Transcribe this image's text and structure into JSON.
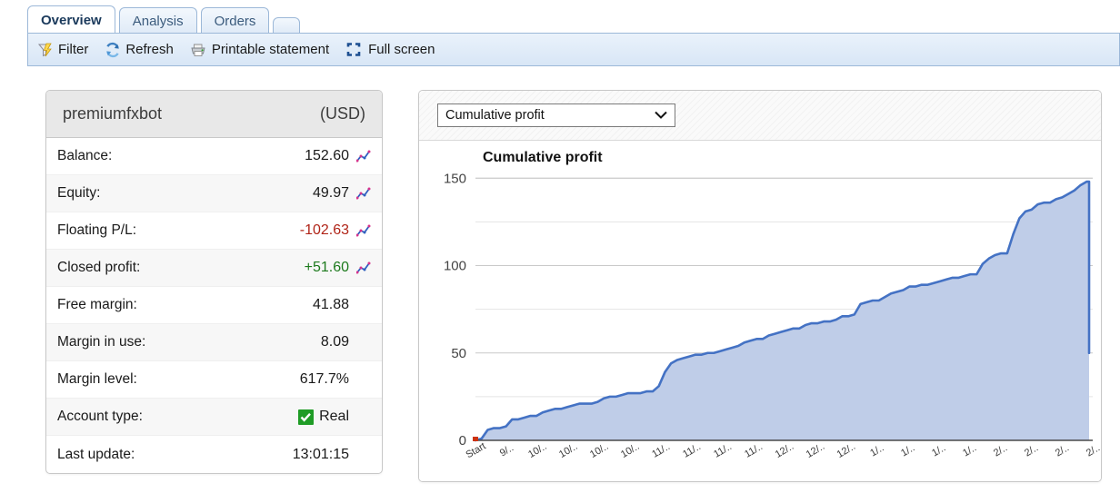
{
  "tabs": [
    {
      "label": "Overview",
      "active": true
    },
    {
      "label": "Analysis",
      "active": false
    },
    {
      "label": "Orders",
      "active": false
    },
    {
      "label": "",
      "active": false
    }
  ],
  "toolbar": {
    "filter_label": "Filter",
    "refresh_label": "Refresh",
    "printable_label": "Printable statement",
    "fullscreen_label": "Full screen"
  },
  "account": {
    "name": "premiumfxbot",
    "currency": "(USD)",
    "rows": [
      {
        "label": "Balance:",
        "value": "152.60",
        "tone": "",
        "icon": "chart-icon"
      },
      {
        "label": "Equity:",
        "value": "49.97",
        "tone": "",
        "icon": "chart-icon"
      },
      {
        "label": "Floating P/L:",
        "value": "-102.63",
        "tone": "neg",
        "icon": "chart-icon"
      },
      {
        "label": "Closed profit:",
        "value": "+51.60",
        "tone": "pos",
        "icon": "chart-icon"
      },
      {
        "label": "Free margin:",
        "value": "41.88",
        "tone": "",
        "icon": ""
      },
      {
        "label": "Margin in use:",
        "value": "8.09",
        "tone": "",
        "icon": ""
      },
      {
        "label": "Margin level:",
        "value": "617.7%",
        "tone": "",
        "icon": ""
      },
      {
        "label": "Account type:",
        "value": "Real",
        "tone": "",
        "icon": "check-box"
      },
      {
        "label": "Last update:",
        "value": "13:01:15",
        "tone": "",
        "icon": ""
      }
    ]
  },
  "chart_panel": {
    "selected_option": "Cumulative profit",
    "options": [
      "Cumulative profit"
    ]
  },
  "chart_data": {
    "type": "area",
    "title": "Cumulative profit",
    "xlabel": "",
    "ylabel": "",
    "ylim": [
      0,
      160
    ],
    "yticks": [
      0,
      50,
      100,
      150
    ],
    "ytick_labels": [
      "0",
      "50",
      "100",
      "150"
    ],
    "minor_gridlines": [
      25,
      75,
      125,
      150
    ],
    "grid": true,
    "legend": "none",
    "line_color": "#4472c4",
    "fill_color": "#bfcde8",
    "start_marker_color": "#cc3311",
    "xtick_labels": [
      "Start",
      "9/..",
      "10/..",
      "10/..",
      "10/..",
      "10/..",
      "11/..",
      "11/..",
      "11/..",
      "11/..",
      "12/..",
      "12/..",
      "12/..",
      "1/..",
      "1/..",
      "1/..",
      "1/..",
      "2/..",
      "2/..",
      "2/..",
      "2/.."
    ],
    "x": [
      0,
      1,
      2,
      3,
      4,
      5,
      6,
      7,
      8,
      9,
      10,
      11,
      12,
      13,
      14,
      15,
      16,
      17,
      18,
      19,
      20,
      21,
      22,
      23,
      24,
      25,
      26,
      27,
      28,
      29,
      30,
      31,
      32,
      33,
      34,
      35,
      36,
      37,
      38,
      39,
      40,
      41,
      42,
      43,
      44,
      45,
      46,
      47,
      48,
      49,
      50,
      51,
      52,
      53,
      54,
      55,
      56,
      57,
      58,
      59,
      60,
      61,
      62,
      63,
      64,
      65,
      66,
      67,
      68,
      69,
      70,
      71,
      72,
      73,
      74,
      75,
      76,
      77,
      78,
      79,
      80,
      81,
      82,
      83,
      84,
      85,
      86,
      87,
      88,
      89,
      90,
      91,
      92,
      93,
      94,
      95,
      96,
      97,
      98,
      99,
      100
    ],
    "values": [
      0,
      1,
      6,
      7,
      7,
      8,
      12,
      12,
      13,
      14,
      14,
      16,
      17,
      18,
      18,
      19,
      20,
      21,
      21,
      21,
      22,
      24,
      25,
      25,
      26,
      27,
      27,
      27,
      28,
      28,
      31,
      39,
      44,
      46,
      47,
      48,
      49,
      49,
      50,
      50,
      51,
      52,
      53,
      54,
      56,
      57,
      58,
      58,
      60,
      61,
      62,
      63,
      64,
      64,
      66,
      67,
      67,
      68,
      68,
      69,
      71,
      71,
      72,
      78,
      79,
      80,
      80,
      82,
      84,
      85,
      86,
      88,
      88,
      89,
      89,
      90,
      91,
      92,
      93,
      93,
      94,
      95,
      95,
      101,
      104,
      106,
      107,
      107,
      118,
      127,
      131,
      132,
      135,
      136,
      136,
      138,
      139,
      141,
      143,
      146,
      148
    ],
    "final_drop_value": 50,
    "annotation": "Line ends with a sharp vertical drop from 148 to 50 at the right edge"
  }
}
